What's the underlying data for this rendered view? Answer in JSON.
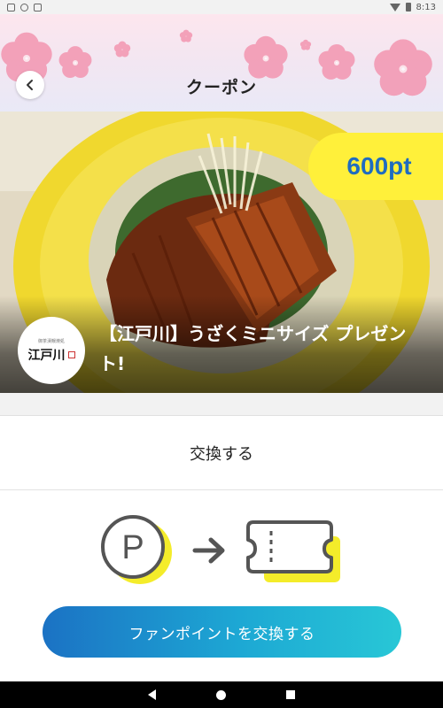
{
  "status_bar": {
    "time": "8:13",
    "icons": [
      "notification-icon",
      "sync-icon",
      "clipboard-icon",
      "wifi-icon",
      "battery-icon"
    ]
  },
  "header": {
    "title": "クーポン",
    "back_icon": "chevron-left-icon",
    "decoration": "cherry-blossoms"
  },
  "coupon": {
    "points": "600pt",
    "title": "【江戸川】うざくミニサイズ プレゼント!",
    "shop_logo_text": "江戸川",
    "shop_logo_sub": "御茶漬鰻焼処"
  },
  "exchange_section": {
    "title": "交換する",
    "diagram_icons": [
      "points-icon",
      "arrow-right-icon",
      "ticket-icon"
    ],
    "points_glyph": "P"
  },
  "cta": {
    "label": "ファンポイントを交換する"
  },
  "nav": {
    "buttons": [
      "back-nav",
      "home-nav",
      "recent-apps-nav"
    ]
  },
  "colors": {
    "badge_bg": "#fff03a",
    "badge_text": "#1f6cc0",
    "cta_start": "#1b72c4",
    "cta_end": "#28c7d6",
    "accent_yellow": "#f4ec2a"
  }
}
